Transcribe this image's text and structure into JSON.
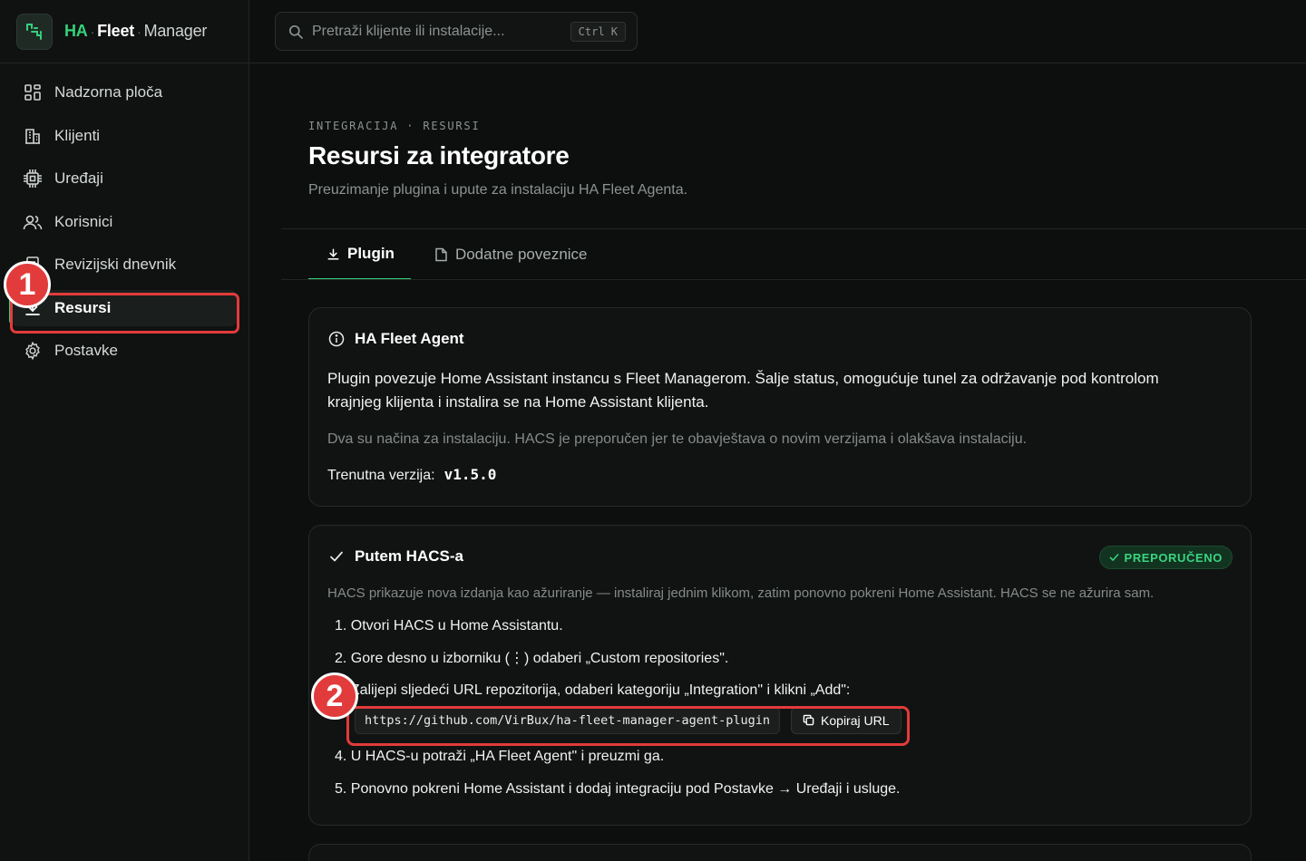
{
  "brand": {
    "ha": "HA",
    "sep1": "·",
    "fleet": "Fleet",
    "sep2": "·",
    "manager": "Manager"
  },
  "search": {
    "placeholder": "Pretraži klijente ili instalacije...",
    "shortcut": "Ctrl K"
  },
  "sidebar": {
    "items": [
      {
        "label": "Nadzorna ploča",
        "icon": "dashboard-icon"
      },
      {
        "label": "Klijenti",
        "icon": "building-icon"
      },
      {
        "label": "Uređaji",
        "icon": "chip-icon"
      },
      {
        "label": "Korisnici",
        "icon": "users-icon"
      },
      {
        "label": "Revizijski dnevnik",
        "icon": "log-icon"
      },
      {
        "label": "Resursi",
        "icon": "download-icon",
        "active": true
      },
      {
        "label": "Postavke",
        "icon": "gear-icon"
      }
    ]
  },
  "annotations": {
    "marker1": "1",
    "marker2": "2"
  },
  "page": {
    "breadcrumb": [
      "INTEGRACIJA",
      "RESURSI"
    ],
    "breadcrumb_sep": "·",
    "title": "Resursi za integratore",
    "subtitle": "Preuzimanje plugina i upute za instalaciju HA Fleet Agenta.",
    "tabs": [
      {
        "label": "Plugin",
        "icon": "download-icon",
        "active": true
      },
      {
        "label": "Dodatne poveznice",
        "icon": "document-icon"
      }
    ]
  },
  "agent_card": {
    "title": "HA Fleet Agent",
    "description": "Plugin povezuje Home Assistant instancu s Fleet Managerom. Šalje status, omogućuje tunel za održavanje pod kontrolom krajnjeg klijenta i instalira se na Home Assistant klijenta.",
    "note": "Dva su načina za instalaciju. HACS je preporučen jer te obavještava o novim verzijama i olakšava instalaciju.",
    "version_label": "Trenutna verzija:",
    "version": "v1.5.0"
  },
  "hacs_card": {
    "title": "Putem HACS-a",
    "badge": "PREPORUČENO",
    "intro": "HACS prikazuje nova izdanja kao ažuriranje — instaliraj jednim klikom, zatim ponovno pokreni Home Assistant. HACS se ne ažurira sam.",
    "steps": [
      "1. Otvori HACS u Home Assistantu.",
      "2. Gore desno u izborniku (⋮) odaberi „Custom repositories\".",
      "3. Zalijepi sljedeći URL repozitorija, odaberi kategoriju „Integration\" i klikni „Add\":",
      "4. U HACS-u potraži „HA Fleet Agent\" i preuzmi ga.",
      "5. Ponovno pokreni Home Assistant i dodaj integraciju pod Postavke → Uređaji i usluge."
    ],
    "repo_url": "https://github.com/VirBux/ha-fleet-manager-agent-plugin",
    "copy_label": "Kopiraj URL"
  },
  "colors": {
    "accent": "#34d27b",
    "highlight": "#e23b3b",
    "background": "#0d0f0e"
  }
}
